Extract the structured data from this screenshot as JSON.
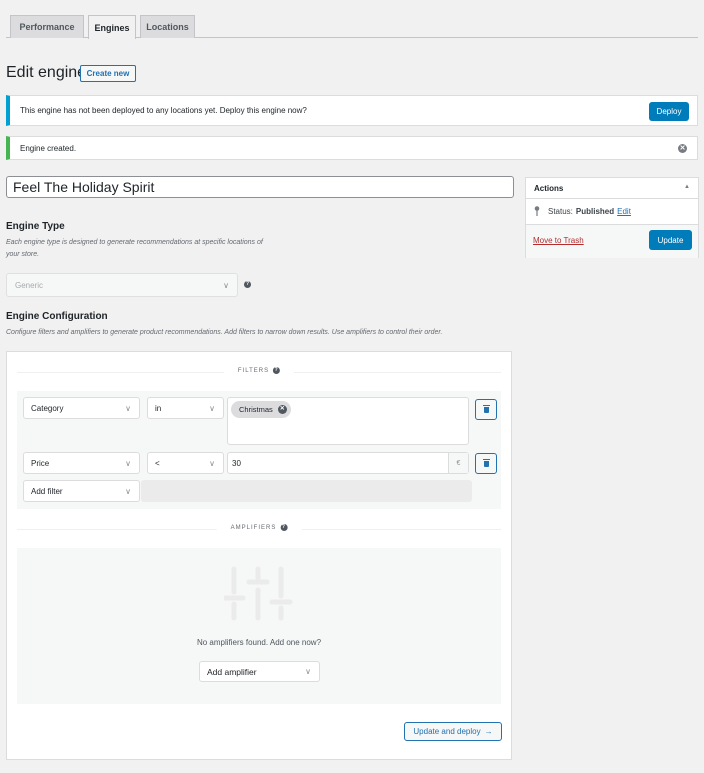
{
  "tabs": [
    {
      "label": "Performance",
      "active": false
    },
    {
      "label": "Engines",
      "active": true
    },
    {
      "label": "Locations",
      "active": false
    }
  ],
  "header": {
    "title": "Edit engine",
    "create_new_label": "Create new"
  },
  "notices": {
    "info": {
      "text": "This engine has not been deployed to any locations yet. Deploy this engine now?",
      "button_label": "Deploy",
      "color": "#00a0d2"
    },
    "success": {
      "text": "Engine created.",
      "dismiss_icon": "✕",
      "color": "#46b450"
    }
  },
  "engine": {
    "title_value": "Feel The Holiday Spirit"
  },
  "engine_type": {
    "heading": "Engine Type",
    "description": "Each engine type is designed to generate recommendations at specific locations of your store.",
    "selected": "Generic",
    "help_icon": "?"
  },
  "engine_config": {
    "heading": "Engine Configuration",
    "description": "Configure filters and amplifiers to generate product recommendations. Add filters to narrow down results. Use amplifiers to control their order.",
    "filters_label": "FILTERS",
    "amplifiers_label": "AMPLIFIERS",
    "filters": [
      {
        "attribute": "Category",
        "operator": "in",
        "tags": [
          "Christmas"
        ]
      },
      {
        "attribute": "Price",
        "operator": "<",
        "value": "30",
        "unit": "€"
      }
    ],
    "add_filter_label": "Add filter",
    "amplifiers_empty_text": "No amplifiers found. Add one now?",
    "add_amplifier_label": "Add amplifier",
    "update_deploy_label": "Update and deploy",
    "update_deploy_arrow": "→"
  },
  "actions_box": {
    "heading": "Actions",
    "toggle_icon": "▲",
    "status_label": "Status:",
    "status_value": "Published",
    "edit_label": "Edit",
    "trash_label": "Move to Trash",
    "update_label": "Update"
  },
  "icons": {
    "chevron": "∨",
    "pin": "📍"
  },
  "colors": {
    "primary": "#007cba",
    "link": "#2271b1",
    "danger": "#b32d2e"
  }
}
